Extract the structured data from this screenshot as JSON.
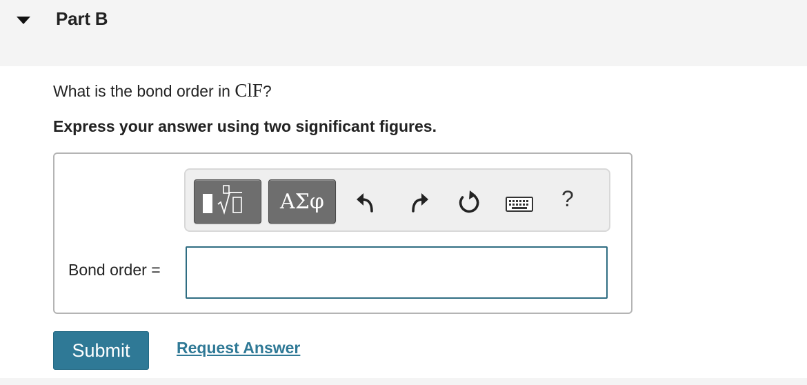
{
  "part": {
    "title": "Part B",
    "expanded": true
  },
  "question": {
    "prefix": "What is the bond order in ",
    "formula": "ClF",
    "suffix": "?",
    "instruction": "Express your answer using two significant figures."
  },
  "toolbar": {
    "greek_label": "ΑΣφ",
    "help_label": "?",
    "buttons": [
      "templates-icon",
      "greek-letters",
      "undo-icon",
      "redo-icon",
      "reset-icon",
      "keyboard-icon",
      "help-icon"
    ]
  },
  "answer": {
    "label": "Bond order =",
    "value": "",
    "placeholder": ""
  },
  "actions": {
    "submit_label": "Submit",
    "request_label": "Request Answer"
  },
  "colors": {
    "accent": "#2f7996",
    "input_border": "#2f6d82",
    "header_bg": "#f4f4f4",
    "toolbar_button": "#6e6e6e"
  }
}
